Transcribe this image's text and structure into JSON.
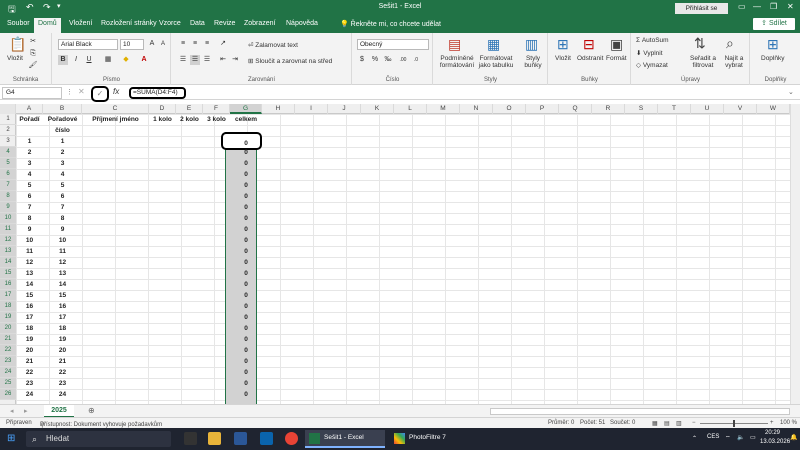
{
  "title": "Sešit1  -  Excel",
  "signin": "Přihlásit se",
  "share": "Sdílet",
  "tell_me": "Řekněte mi, co chcete udělat",
  "tabs": [
    "Soubor",
    "Domů",
    "Vložení",
    "Rozložení stránky",
    "Vzorce",
    "Data",
    "Revize",
    "Zobrazení",
    "Nápověda"
  ],
  "ribbon": {
    "clipboard": {
      "paste": "Vložit",
      "label": "Schránka"
    },
    "font": {
      "name": "Arial Black",
      "size": "10",
      "label": "Písmo"
    },
    "alignment": {
      "wrap": "Zalamovat text",
      "merge": "Sloučit a zarovnat na střed",
      "label": "Zarovnání"
    },
    "number": {
      "format": "Obecný",
      "label": "Číslo"
    },
    "styles": {
      "conditional": "Podmíněné formátování",
      "table": "Formátovat jako tabulku",
      "cell_styles": "Styly buňky",
      "label": "Styly"
    },
    "cells": {
      "insert": "Vložit",
      "delete": "Odstranit",
      "format": "Formát",
      "label": "Buňky"
    },
    "editing": {
      "autosum": "AutoSum",
      "fill": "Vyplnit",
      "clear": "Vymazat",
      "sort": "Seřadit a filtrovat",
      "find": "Najít a vybrat",
      "label": "Úpravy"
    },
    "addins": {
      "name": "Doplňky",
      "label": "Doplňky"
    }
  },
  "formula_bar": {
    "name_box": "G4",
    "fx": "fx",
    "formula": "=SUMA(D4:F4)"
  },
  "columns": [
    "A",
    "B",
    "C",
    "D",
    "E",
    "F",
    "G",
    "H",
    "I",
    "J",
    "K",
    "L",
    "M",
    "N",
    "O",
    "P",
    "Q",
    "R",
    "S",
    "T",
    "U",
    "V",
    "W"
  ],
  "header_row1": [
    "Pořadí",
    "Pořadové",
    "Příjmení jméno",
    "1 kolo",
    "2 kolo",
    "3 kolo",
    "celkem"
  ],
  "header_row2_b": "číslo",
  "rows": [
    "1",
    "2",
    "3",
    "4",
    "5",
    "6",
    "7",
    "8",
    "9",
    "10",
    "11",
    "12",
    "13",
    "14",
    "15",
    "16",
    "17",
    "18",
    "19",
    "20",
    "21",
    "22",
    "23",
    "24"
  ],
  "row_numbers": [
    "1",
    "2",
    "3",
    "4",
    "5",
    "6",
    "7",
    "8",
    "9",
    "10",
    "11",
    "12",
    "13",
    "14",
    "15",
    "16",
    "17",
    "18",
    "19",
    "20",
    "21",
    "22",
    "23",
    "24",
    "25",
    "26"
  ],
  "g_values": [
    "0",
    "0",
    "0",
    "0",
    "0",
    "0",
    "0",
    "0",
    "0",
    "0",
    "0",
    "0",
    "0",
    "0",
    "0",
    "0",
    "0",
    "0",
    "0",
    "0",
    "0",
    "0",
    "0",
    "0"
  ],
  "sheet_tab": "2025",
  "status": {
    "ready": "Připraven",
    "accessibility": "Přístupnost: Dokument vyhovuje požadavkům",
    "average": "Průměr: 0",
    "count": "Počet: 51",
    "sum": "Součet: 0",
    "zoom": "100 %"
  },
  "taskbar": {
    "search": "Hledat",
    "excel_window": "Sešit1 - Excel",
    "photofiltre": "PhotoFiltre 7",
    "lang": "CES",
    "time": "20:29",
    "date": "13.03.2026"
  },
  "colors": {
    "excel_green": "#217346",
    "taskbar": "#1f2430"
  }
}
